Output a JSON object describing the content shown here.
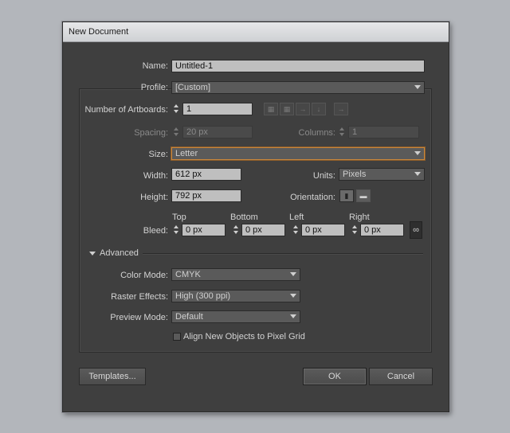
{
  "window": {
    "title": "New Document"
  },
  "name": {
    "label": "Name:",
    "value": "Untitled-1"
  },
  "profile": {
    "label": "Profile:",
    "value": "[Custom]"
  },
  "artboards": {
    "label": "Number of Artboards:",
    "value": "1"
  },
  "spacing": {
    "label": "Spacing:",
    "value": "20 px"
  },
  "columns": {
    "label": "Columns:",
    "value": "1"
  },
  "size": {
    "label": "Size:",
    "value": "Letter"
  },
  "width": {
    "label": "Width:",
    "value": "612 px"
  },
  "units": {
    "label": "Units:",
    "value": "Pixels"
  },
  "height": {
    "label": "Height:",
    "value": "792 px"
  },
  "orientation": {
    "label": "Orientation:"
  },
  "bleed": {
    "label": "Bleed:",
    "top_label": "Top",
    "top_value": "0 px",
    "bottom_label": "Bottom",
    "bottom_value": "0 px",
    "left_label": "Left",
    "left_value": "0 px",
    "right_label": "Right",
    "right_value": "0 px"
  },
  "advanced": {
    "label": "Advanced",
    "color_mode_label": "Color Mode:",
    "color_mode_value": "CMYK",
    "raster_label": "Raster Effects:",
    "raster_value": "High (300 ppi)",
    "preview_label": "Preview Mode:",
    "preview_value": "Default",
    "align_label": "Align New Objects to Pixel Grid",
    "align_checked": false
  },
  "buttons": {
    "templates": "Templates...",
    "ok": "OK",
    "cancel": "Cancel"
  },
  "icons": {
    "arrange_grid_row": "grid-by-row-icon",
    "arrange_grid_col": "grid-by-column-icon",
    "arrange_row": "arrange-by-row-icon",
    "arrange_col": "arrange-by-column-icon",
    "rtl": "right-to-left-icon",
    "portrait": "portrait-icon",
    "landscape": "landscape-icon",
    "link": "link-icon"
  },
  "colors": {
    "focus_border": "#c9873c",
    "dialog_bg": "#3f3f3f"
  }
}
